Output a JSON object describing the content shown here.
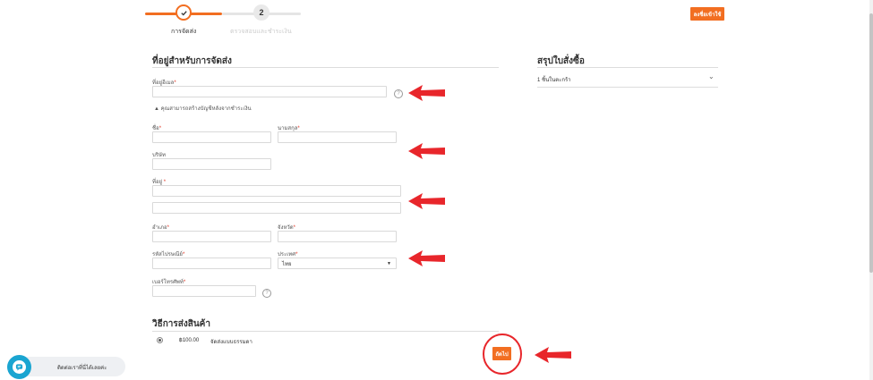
{
  "steps": [
    {
      "label": "การจัดส่ง",
      "number": "1"
    },
    {
      "label": "ตรวจสอบและชำระเงิน",
      "number": "2"
    }
  ],
  "header": {
    "signin_label": "ลงชื่อเข้าใช้"
  },
  "form": {
    "title": "ที่อยู่สำหรับการจัดส่ง",
    "email_label": "ที่อยู่อีเมล",
    "account_note": "คุณสามารถสร้างบัญชีหลังจากชำระเงิน",
    "firstname_label": "ชื่อ",
    "lastname_label": "นามสกุล",
    "company_label": "บริษัท",
    "address_label": "ที่อยู่",
    "district_label": "อำเภอ",
    "province_label": "จังหวัด",
    "postcode_label": "รหัสไปรษณีย์",
    "country_label": "ประเทศ",
    "country_value": "ไทย",
    "phone_label": "เบอร์โทรศัพท์",
    "required_mark": "*",
    "help_mark": "?"
  },
  "summary": {
    "title": "สรุปใบสั่งซื้อ",
    "cart_count": "1 ชิ้นในตะกร้า"
  },
  "shipping": {
    "title": "วิธีการส่งสินค้า",
    "price": "฿100.00",
    "method": "จัดส่งแบบธรรมดา"
  },
  "next_label": "ถัดไป",
  "chat": {
    "label": "ติดต่อเราที่นี่ได้เลยค่ะ"
  },
  "colors": {
    "accent": "#f26e21",
    "arrow": "#e8262b"
  }
}
